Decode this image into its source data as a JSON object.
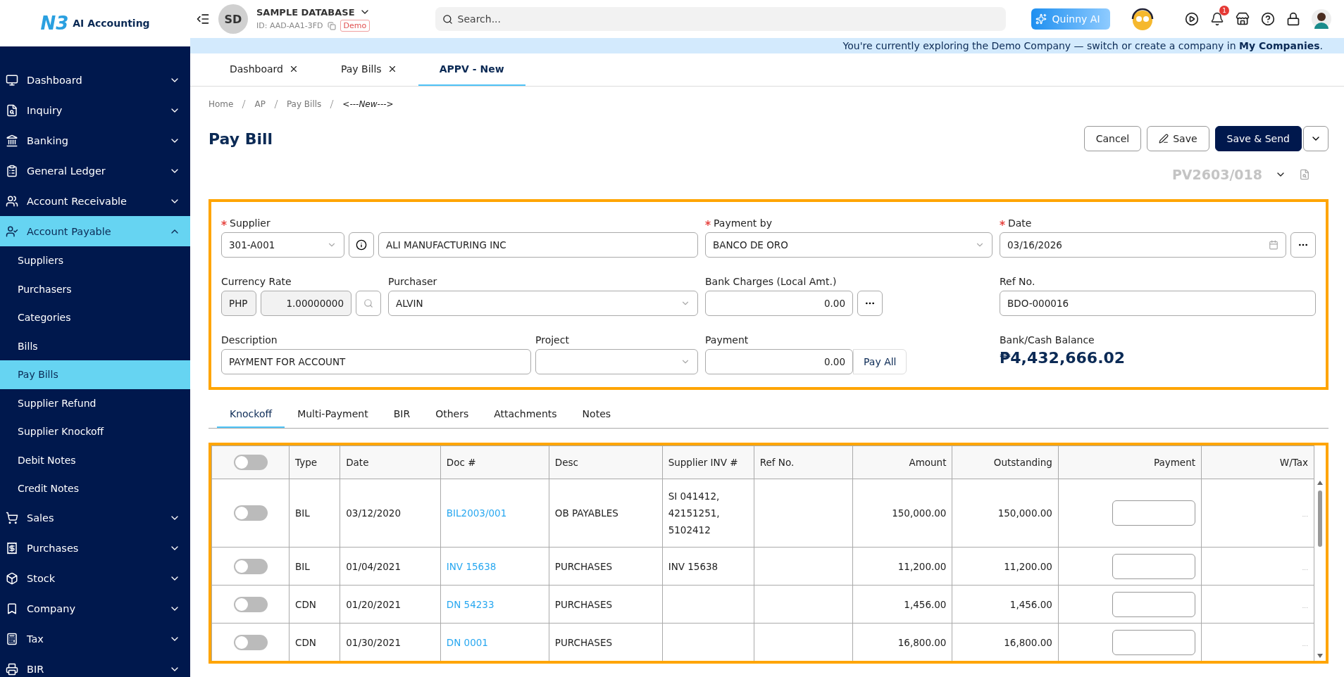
{
  "brand": {
    "logo_mark": "N3",
    "name": "AI Accounting"
  },
  "header": {
    "avatar": "SD",
    "database": "SAMPLE DATABASE",
    "db_id": "ID: AAD-AA1-3FD",
    "badge": "Demo",
    "search": {
      "placeholder": "Search..."
    },
    "assistant": "Quinny AI",
    "notifications": "1"
  },
  "banner": {
    "text": "You're currently exploring the Demo Company — switch or create a company in **My Companies**."
  },
  "sidebar": {
    "items": [
      {
        "label": "Dashboard",
        "expanded": false,
        "selected": false
      },
      {
        "label": "Inquiry",
        "expanded": false,
        "selected": false
      },
      {
        "label": "Banking",
        "expanded": false,
        "selected": false
      },
      {
        "label": "General Ledger",
        "expanded": false,
        "selected": false
      },
      {
        "label": "Account Receivable",
        "expanded": false,
        "selected": false
      },
      {
        "label": "Account Payable",
        "expanded": true,
        "selected": true,
        "children": [
          {
            "label": "Suppliers",
            "selected": false
          },
          {
            "label": "Purchasers",
            "selected": false
          },
          {
            "label": "Categories",
            "selected": false
          },
          {
            "label": "Bills",
            "selected": false
          },
          {
            "label": "Pay Bills",
            "selected": true
          },
          {
            "label": "Supplier Refund",
            "selected": false
          },
          {
            "label": "Supplier Knockoff",
            "selected": false
          },
          {
            "label": "Debit Notes",
            "selected": false
          },
          {
            "label": "Credit Notes",
            "selected": false
          }
        ]
      },
      {
        "label": "Sales",
        "expanded": false,
        "selected": false
      },
      {
        "label": "Purchases",
        "expanded": false,
        "selected": false
      },
      {
        "label": "Stock",
        "expanded": false,
        "selected": false
      },
      {
        "label": "Company",
        "expanded": false,
        "selected": false
      },
      {
        "label": "Tax",
        "expanded": false,
        "selected": false
      },
      {
        "label": "BIR",
        "expanded": false,
        "selected": false
      }
    ]
  },
  "page_tabs": [
    {
      "label": "Dashboard",
      "closable": true,
      "selected": false
    },
    {
      "label": "Pay Bills",
      "closable": true,
      "selected": false
    },
    {
      "label": "APPV - New",
      "closable": false,
      "selected": true
    }
  ],
  "breadcrumb": [
    "Home",
    "AP",
    "Pay Bills",
    "<---New--->"
  ],
  "title": "Pay Bill",
  "actions": [
    {
      "label": "Cancel",
      "kind": "outline"
    },
    {
      "label": "Save",
      "kind": "icon"
    },
    {
      "label": "Save & Send",
      "kind": "primary"
    }
  ],
  "doc_number": "PV2603/018",
  "form": {
    "supplier": {
      "label": "Supplier",
      "required": true,
      "code": "301-A001",
      "name": "ALI MANUFACTURING INC"
    },
    "payment_by": {
      "label": "Payment by",
      "required": true,
      "value": "BANCO DE ORO"
    },
    "date": {
      "label": "Date",
      "required": true,
      "value": "03/16/2026"
    },
    "currency_rate": {
      "label": "Currency Rate",
      "currency": "PHP",
      "value": "1.00000000"
    },
    "purchaser": {
      "label": "Purchaser",
      "value": "ALVIN"
    },
    "bank_charges": {
      "label": "Bank Charges (Local Amt.)",
      "value": "0.00"
    },
    "ref_no": {
      "label": "Ref No.",
      "value": "BDO-000016"
    },
    "description": {
      "label": "Description",
      "value": "PAYMENT FOR ACCOUNT"
    },
    "project": {
      "label": "Project"
    },
    "payment": {
      "label": "Payment",
      "value": "0.00",
      "button": "Pay All"
    },
    "balance": {
      "label": "Bank/Cash Balance",
      "value": "₱4,432,666.02"
    }
  },
  "section_tabs": [
    {
      "label": "Knockoff",
      "selected": true
    },
    {
      "label": "Multi-Payment",
      "selected": false
    },
    {
      "label": "BIR",
      "selected": false
    },
    {
      "label": "Others",
      "selected": false
    },
    {
      "label": "Attachments",
      "selected": false
    },
    {
      "label": "Notes",
      "selected": false
    }
  ],
  "table": {
    "select_all_on": false,
    "columns": [
      "Type",
      "Date",
      "Doc #",
      "Desc",
      "Supplier INV #",
      "Ref No.",
      "Amount",
      "Outstanding",
      "Payment",
      "W/Tax"
    ],
    "rows": [
      {
        "on": false,
        "type": "BIL",
        "date": "03/12/2020",
        "doc": "BIL2003/001",
        "desc": "OB PAYABLES",
        "supplier_inv": "SI 041412, 42151251, 5102412",
        "amount": "150,000.00",
        "outstanding": "150,000.00",
        "w_tax": "..."
      },
      {
        "on": false,
        "type": "BIL",
        "date": "01/04/2021",
        "doc": "INV 15638",
        "desc": "PURCHASES",
        "supplier_inv": "INV 15638",
        "amount": "11,200.00",
        "outstanding": "11,200.00",
        "w_tax": "..."
      },
      {
        "on": false,
        "type": "CDN",
        "date": "01/20/2021",
        "doc": "DN 54233",
        "desc": "PURCHASES",
        "amount": "1,456.00",
        "outstanding": "1,456.00",
        "w_tax": "..."
      },
      {
        "on": false,
        "type": "CDN",
        "date": "01/30/2021",
        "doc": "DN 0001",
        "desc": "PURCHASES",
        "amount": "16,800.00",
        "outstanding": "16,800.00",
        "w_tax": "..."
      }
    ]
  }
}
